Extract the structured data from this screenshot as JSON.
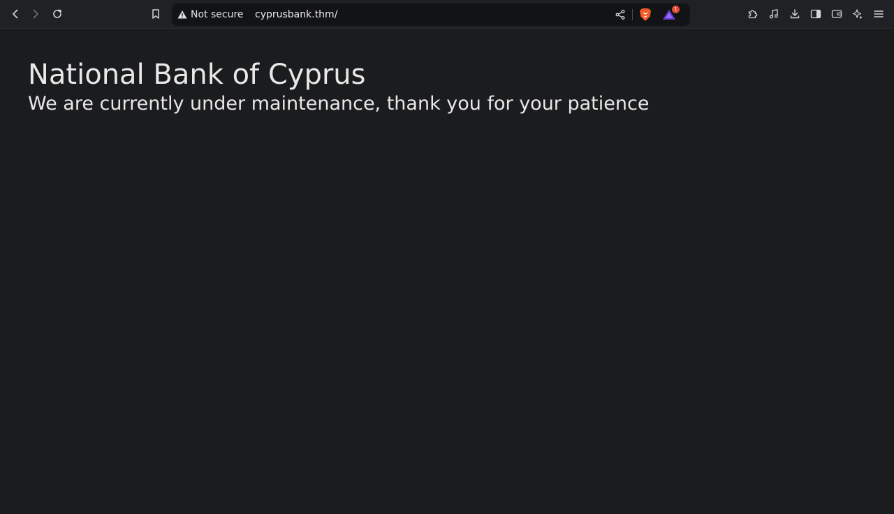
{
  "browser": {
    "security_label": "Not secure",
    "url": "cyprusbank.thm/",
    "rewards_badge_count": "1",
    "icons": {
      "back": "chevron-left",
      "forward": "chevron-right",
      "reload": "reload",
      "bookmark": "bookmark",
      "warning": "warning-triangle",
      "share": "share",
      "shields": "brave-lion",
      "rewards": "brave-rewards",
      "extensions": "puzzle",
      "media": "music-note",
      "downloads": "download",
      "sidebar": "sidebar",
      "wallet": "wallet",
      "leo": "sparkle",
      "menu": "hamburger"
    },
    "colors": {
      "shields_orange": "#f05a28",
      "rewards_purple": "#6a3fd6",
      "badge_red": "#e34b35"
    }
  },
  "page": {
    "title": "National Bank of Cyprus",
    "subtitle": "We are currently under maintenance, thank you for your patience"
  }
}
